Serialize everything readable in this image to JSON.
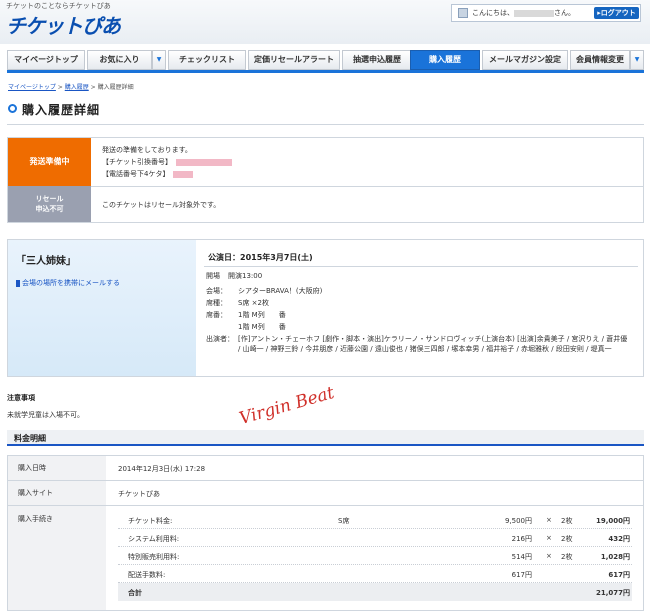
{
  "header": {
    "tagline": "チケットのことならチケットぴあ",
    "logo": "チケットぴあ",
    "greeting_prefix": "こんにちは、",
    "greeting_suffix": "さん。",
    "logout": "▸ログアウト"
  },
  "nav": {
    "tabs": [
      {
        "label": "マイページトップ"
      },
      {
        "label": "お気に入り"
      },
      {
        "label": "チェックリスト"
      },
      {
        "label": "定価リセールアラート"
      },
      {
        "label": "抽選申込履歴"
      },
      {
        "label": "購入履歴"
      },
      {
        "label": "メールマガジン設定"
      },
      {
        "label": "会員情報変更"
      }
    ],
    "dropdown_glyph": "▼"
  },
  "breadcrumb": {
    "items": [
      "マイページトップ",
      "購入履歴",
      "購入履歴詳細"
    ],
    "separator": " > "
  },
  "page_title": "購入履歴詳細",
  "status": {
    "shipping_badge": "発送準備中",
    "shipping_lines": [
      "発送の準備をしております。",
      "【チケット引換番号】",
      "【電話番号下4ケタ】"
    ],
    "resale_badge_line1": "リセール",
    "resale_badge_line2": "申込不可",
    "resale_text": "このチケットはリセール対象外です。"
  },
  "event": {
    "name": "「三人姉妹」",
    "mail_link": "会場の場所を携帯にメールする",
    "performance_date": "公演日：2015年3月7日(土)",
    "open_label": "開場",
    "open_value": "開演13:00",
    "venue_label": "会場：",
    "venue_value": "シアターBRAVA！(大阪府)",
    "seat_type_label": "席種：",
    "seat_type_value": "S席 ×2枚",
    "seat_no_label": "席番：",
    "seat_no_1": "1階 M列　　番",
    "seat_no_2": "1階 M列　　番",
    "cast_label": "出演者：",
    "cast_value": "[作]アントン・チェーホフ [劇作・脚本・演出]ケラリーノ・サンドロヴィッチ(上演台本) [出演]余貴美子 / 宮沢りえ / 蒼井優 / 山崎一 / 神野三鈴 / 今井朋彦 / 近藤公園 / 遠山俊也 / 猪俣三四郎 / 塚本幸男 / 福井裕子 / 赤堀雅秋 / 段田安則 / 堤真一"
  },
  "notes": {
    "heading": "注意事項",
    "body": "未就学児童は入場不可。"
  },
  "watermark": "Virgin Beat",
  "fees": {
    "heading": "料金明細",
    "purchase_date_label": "購入日時",
    "purchase_date": "2014年12月3日(水) 17:28",
    "purchase_site_label": "購入サイト",
    "purchase_site": "チケットぴあ",
    "procedure_label": "購入手続き",
    "rows": [
      {
        "name": "チケット料金:",
        "seat": "S席",
        "unit": "9,500円",
        "times": "×",
        "qty": "2枚",
        "amount": "19,000円"
      },
      {
        "name": "システム利用料:",
        "seat": "",
        "unit": "216円",
        "times": "×",
        "qty": "2枚",
        "amount": "432円"
      },
      {
        "name": "特別販売利用料:",
        "seat": "",
        "unit": "514円",
        "times": "×",
        "qty": "2枚",
        "amount": "1,028円"
      },
      {
        "name": "配送手数料:",
        "seat": "",
        "unit": "617円",
        "times": "",
        "qty": "",
        "amount": "617円"
      }
    ],
    "total_label": "合計",
    "total_amount": "21,077円"
  },
  "colors": {
    "accent_blue": "#1a73d9",
    "shipping_orange": "#ef6c00",
    "resale_gray": "#9aa0b0",
    "watermark_red": "#d0302a"
  }
}
